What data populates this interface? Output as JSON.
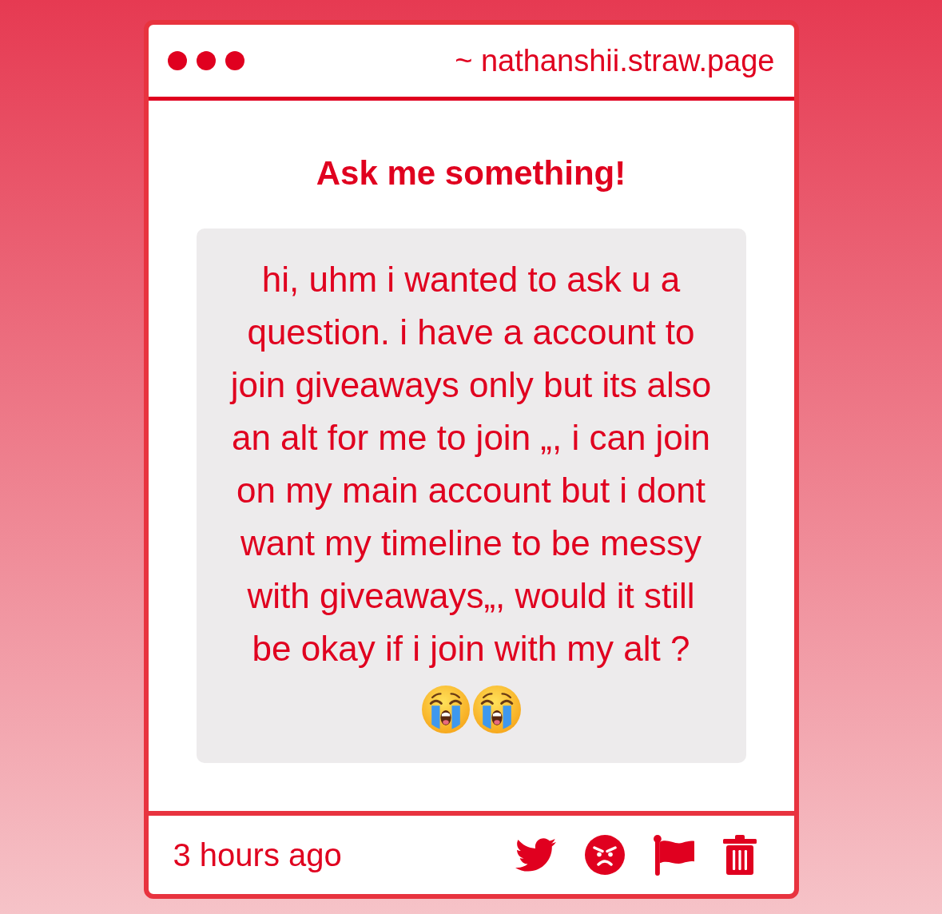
{
  "window": {
    "url": "~ nathanshii.straw.page"
  },
  "question": {
    "title": "Ask me something!",
    "text": "hi, uhm i wanted to ask u a question. i have a account to join giveaways only but its also an alt for me to join „, i can join on my main account but i dont want my timeline to be messy with giveaways„, would it still be okay if i join with my alt ?"
  },
  "footer": {
    "time": "3 hours ago"
  }
}
